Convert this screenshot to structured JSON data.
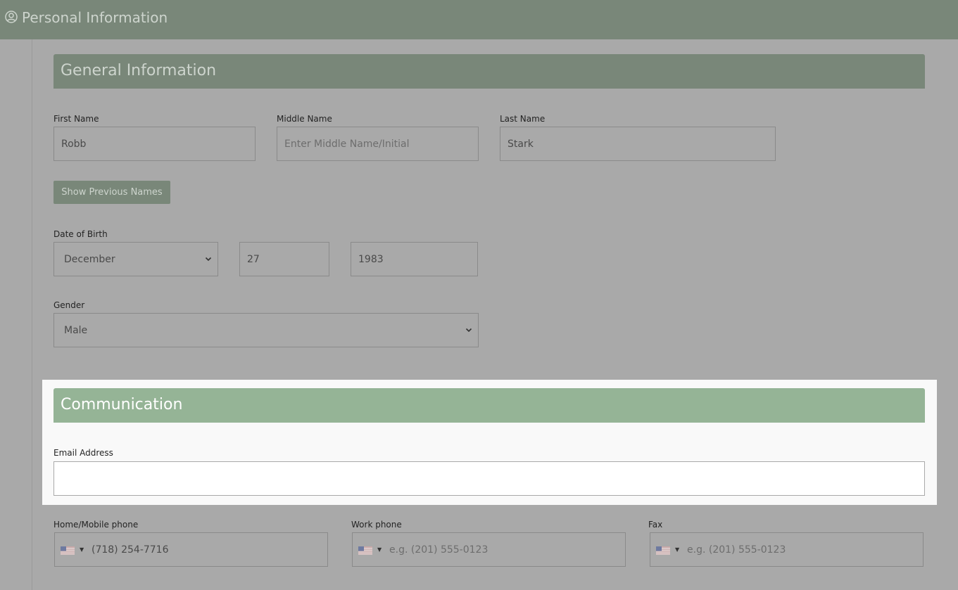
{
  "header": {
    "title": "Personal Information",
    "icon": "user-circle-icon"
  },
  "general": {
    "title": "General Information",
    "first_name": {
      "label": "First Name",
      "value": "Robb"
    },
    "middle_name": {
      "label": "Middle Name",
      "placeholder": "Enter Middle Name/Initial"
    },
    "last_name": {
      "label": "Last Name",
      "value": "Stark"
    },
    "show_previous_names": "Show Previous Names",
    "dob": {
      "label": "Date of Birth",
      "month": "December",
      "day": "27",
      "year": "1983"
    },
    "gender": {
      "label": "Gender",
      "value": "Male"
    }
  },
  "communication": {
    "title": "Communication",
    "email": {
      "label": "Email Address",
      "value": ""
    },
    "home_phone": {
      "label": "Home/Mobile phone",
      "value": "(718) 254-7716",
      "country": "US"
    },
    "work_phone": {
      "label": "Work phone",
      "placeholder": "e.g. (201) 555-0123",
      "country": "US"
    },
    "fax": {
      "label": "Fax",
      "placeholder": "e.g. (201) 555-0123",
      "country": "US"
    }
  },
  "colors": {
    "header": "#798779",
    "comm_header": "#95b496",
    "overlay": "#a9a9a9"
  }
}
